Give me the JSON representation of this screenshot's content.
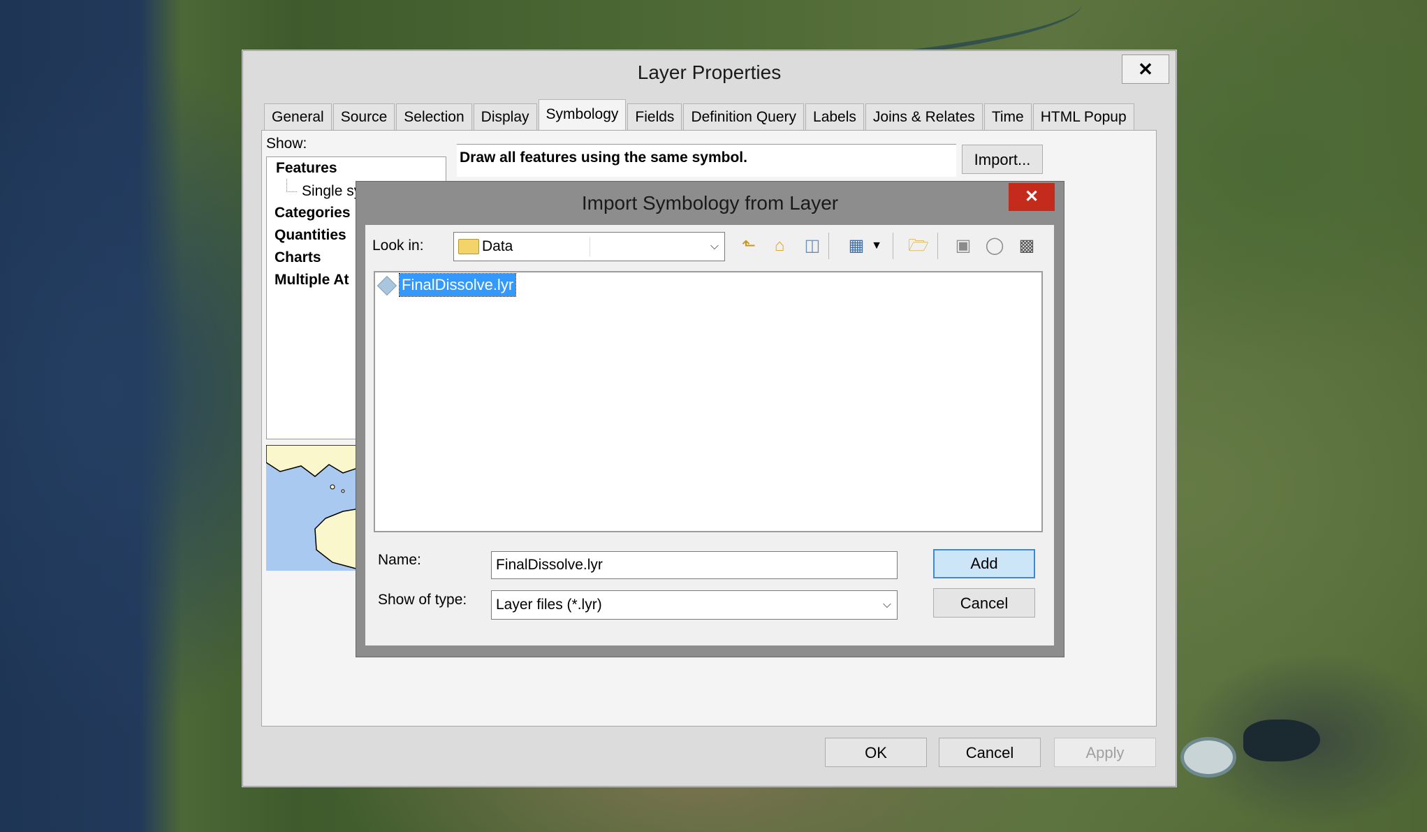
{
  "layer_properties": {
    "title": "Layer Properties",
    "close_glyph": "✕",
    "tabs": [
      "General",
      "Source",
      "Selection",
      "Display",
      "Symbology",
      "Fields",
      "Definition Query",
      "Labels",
      "Joins & Relates",
      "Time",
      "HTML Popup"
    ],
    "active_tab": "Symbology",
    "show_label": "Show:",
    "show_tree": {
      "features": "Features",
      "single_symbol": "Single sy",
      "categories": "Categories",
      "quantities": "Quantities",
      "charts": "Charts",
      "multiple_attributes": "Multiple At"
    },
    "description": "Draw all features using the same symbol.",
    "import_button": "Import...",
    "ok_button": "OK",
    "cancel_button": "Cancel",
    "apply_button": "Apply"
  },
  "import_dialog": {
    "title": "Import Symbology from Layer",
    "close_glyph": "✕",
    "look_in_label": "Look in:",
    "look_in_value": "Data",
    "files": [
      "FinalDissolve.lyr"
    ],
    "selected_file": "FinalDissolve.lyr",
    "name_label": "Name:",
    "name_value": "FinalDissolve.lyr",
    "type_label": "Show of type:",
    "type_value": "Layer files (*.lyr)",
    "add_button": "Add",
    "cancel_button": "Cancel",
    "toolbar_icons": [
      "up-one-level-icon",
      "home-icon",
      "connect-folder-icon",
      "view-menu-icon",
      "new-folder-icon",
      "catalog-icon",
      "database-icon",
      "toolbox-icon"
    ]
  },
  "colors": {
    "selection": "#3399ff",
    "close_red": "#c42b1c",
    "add_border": "#3c8ad6"
  }
}
